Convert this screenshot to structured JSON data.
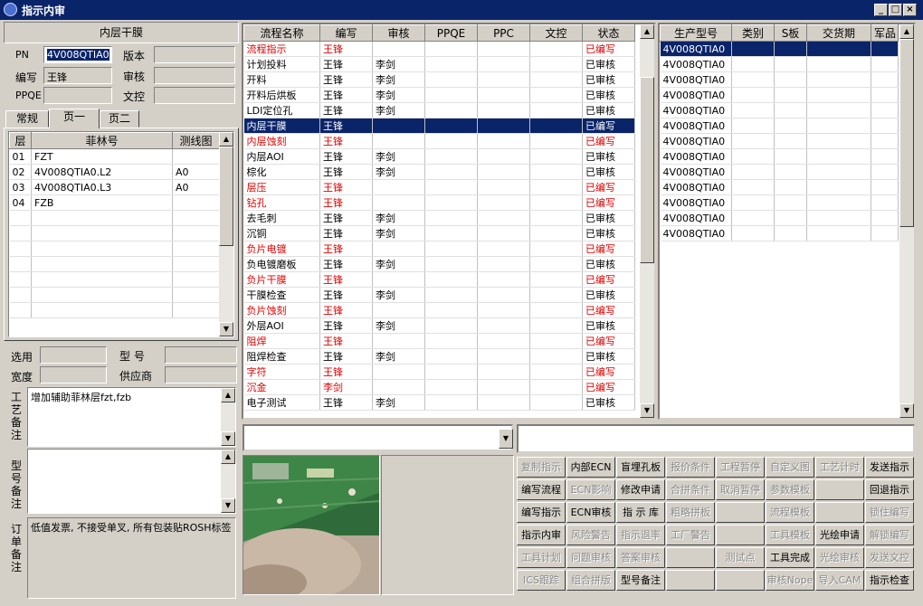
{
  "window": {
    "title": "指示内审"
  },
  "left": {
    "section_title": "内层干膜",
    "fields": {
      "pn_label": "PN",
      "pn_value": "4V008QTIA0",
      "version_label": "版本",
      "version_value": "",
      "author_label": "编写",
      "author_value": "王锋",
      "review_label": "审核",
      "review_value": "",
      "ppqe_label": "PPQE",
      "ppqe_value": "",
      "doc_label": "文控",
      "doc_value": ""
    },
    "tabs": [
      "常规",
      "页一",
      "页二"
    ],
    "layer_table": {
      "headers": [
        "层",
        "菲林号",
        "测线图"
      ],
      "rows": [
        [
          "01",
          "FZT",
          ""
        ],
        [
          "02",
          "4V008QTIA0.L2",
          "A0"
        ],
        [
          "03",
          "4V008QTIA0.L3",
          "A0"
        ],
        [
          "04",
          "FZB",
          ""
        ]
      ]
    },
    "select_label": "选用",
    "select_value": "",
    "model_label": "型 号",
    "model_value": "",
    "width_label": "宽度",
    "width_value": "",
    "supplier_label": "供应商",
    "supplier_value": "",
    "process_note_label": "工艺备注",
    "process_note": "增加辅助菲林层fzt,fzb",
    "model_note_label": "型号备注",
    "model_note": "",
    "order_note_label": "订单备注",
    "order_note": "低值发票, 不接受单叉, 所有包装贴ROSH标签"
  },
  "flow": {
    "headers": [
      "流程名称",
      "编写",
      "审核",
      "PPQE",
      "PPC",
      "文控",
      "状态"
    ],
    "rows": [
      [
        "流程指示",
        "王锋",
        "",
        "",
        "",
        "",
        "已编写",
        "red"
      ],
      [
        "计划投料",
        "王锋",
        "李剑",
        "",
        "",
        "",
        "已审核",
        ""
      ],
      [
        "开料",
        "王锋",
        "李剑",
        "",
        "",
        "",
        "已审核",
        ""
      ],
      [
        "开料后烘板",
        "王锋",
        "李剑",
        "",
        "",
        "",
        "已审核",
        ""
      ],
      [
        "LDI定位孔",
        "王锋",
        "李剑",
        "",
        "",
        "",
        "已审核",
        ""
      ],
      [
        "内层干膜",
        "王锋",
        "",
        "",
        "",
        "",
        "已编写",
        "sel"
      ],
      [
        "内层蚀刻",
        "王锋",
        "",
        "",
        "",
        "",
        "已编写",
        "red"
      ],
      [
        "内层AOI",
        "王锋",
        "李剑",
        "",
        "",
        "",
        "已审核",
        ""
      ],
      [
        "棕化",
        "王锋",
        "李剑",
        "",
        "",
        "",
        "已审核",
        ""
      ],
      [
        "层压",
        "王锋",
        "",
        "",
        "",
        "",
        "已编写",
        "red"
      ],
      [
        "钻孔",
        "王锋",
        "",
        "",
        "",
        "",
        "已编写",
        "red"
      ],
      [
        "去毛刺",
        "王锋",
        "李剑",
        "",
        "",
        "",
        "已审核",
        ""
      ],
      [
        "沉铜",
        "王锋",
        "李剑",
        "",
        "",
        "",
        "已审核",
        ""
      ],
      [
        "负片电镀",
        "王锋",
        "",
        "",
        "",
        "",
        "已编写",
        "red"
      ],
      [
        "负电镀磨板",
        "王锋",
        "李剑",
        "",
        "",
        "",
        "已审核",
        ""
      ],
      [
        "负片干膜",
        "王锋",
        "",
        "",
        "",
        "",
        "已编写",
        "red"
      ],
      [
        "干膜检查",
        "王锋",
        "李剑",
        "",
        "",
        "",
        "已审核",
        ""
      ],
      [
        "负片蚀刻",
        "王锋",
        "",
        "",
        "",
        "",
        "已编写",
        "red"
      ],
      [
        "外层AOI",
        "王锋",
        "李剑",
        "",
        "",
        "",
        "已审核",
        ""
      ],
      [
        "阻焊",
        "王锋",
        "",
        "",
        "",
        "",
        "已编写",
        "red"
      ],
      [
        "阻焊检查",
        "王锋",
        "李剑",
        "",
        "",
        "",
        "已审核",
        ""
      ],
      [
        "字符",
        "王锋",
        "",
        "",
        "",
        "",
        "已编写",
        "red"
      ],
      [
        "沉金",
        "李剑",
        "",
        "",
        "",
        "",
        "已编写",
        "red"
      ],
      [
        "电子测试",
        "王锋",
        "李剑",
        "",
        "",
        "",
        "已审核",
        ""
      ]
    ]
  },
  "models": {
    "headers": [
      "生产型号",
      "类别",
      "S板",
      "交货期",
      "军品"
    ],
    "rows": [
      "4V008QTIA0",
      "4V008QTIA0",
      "4V008QTIA0",
      "4V008QTIA0",
      "4V008QTIA0",
      "4V008QTIA0",
      "4V008QTIA0",
      "4V008QTIA0",
      "4V008QTIA0",
      "4V008QTIA0",
      "4V008QTIA0",
      "4V008QTIA0",
      "4V008QTIA0"
    ]
  },
  "buttons": [
    [
      "复制指示",
      "内部ECN",
      "盲埋孔板",
      "报价条件",
      "工程暂停",
      "自定义图",
      "工艺计时",
      "发送指示"
    ],
    [
      "编写流程",
      "ECN影响",
      "修改申请",
      "合拼条件",
      "取消暂停",
      "参数模板",
      "",
      "回退指示"
    ],
    [
      "编写指示",
      "ECN审核",
      "指 示 库",
      "粗略拼板",
      "",
      "流程模板",
      "",
      "锁住编写"
    ],
    [
      "指示内审",
      "风险警告",
      "指示退率",
      "工厂警告",
      "",
      "工具模板",
      "光绘申请",
      "解锁编写"
    ],
    [
      "工具计划",
      "问题审核",
      "答案审核",
      "",
      "测试点",
      "工具完成",
      "光绘审核",
      "发送文控"
    ],
    [
      "ICS跟踪",
      "组合拼版",
      "型号备注",
      "",
      "",
      "审核Nope",
      "导入CAM",
      "指示检查"
    ]
  ],
  "buttons_enabled": [
    [
      0,
      1,
      1,
      0,
      0,
      0,
      0,
      1
    ],
    [
      1,
      0,
      1,
      0,
      0,
      0,
      0,
      1
    ],
    [
      1,
      1,
      1,
      0,
      0,
      0,
      0,
      0
    ],
    [
      1,
      0,
      0,
      0,
      0,
      0,
      1,
      0
    ],
    [
      0,
      0,
      0,
      0,
      0,
      1,
      0,
      0
    ],
    [
      0,
      0,
      1,
      0,
      0,
      0,
      0,
      1
    ]
  ]
}
